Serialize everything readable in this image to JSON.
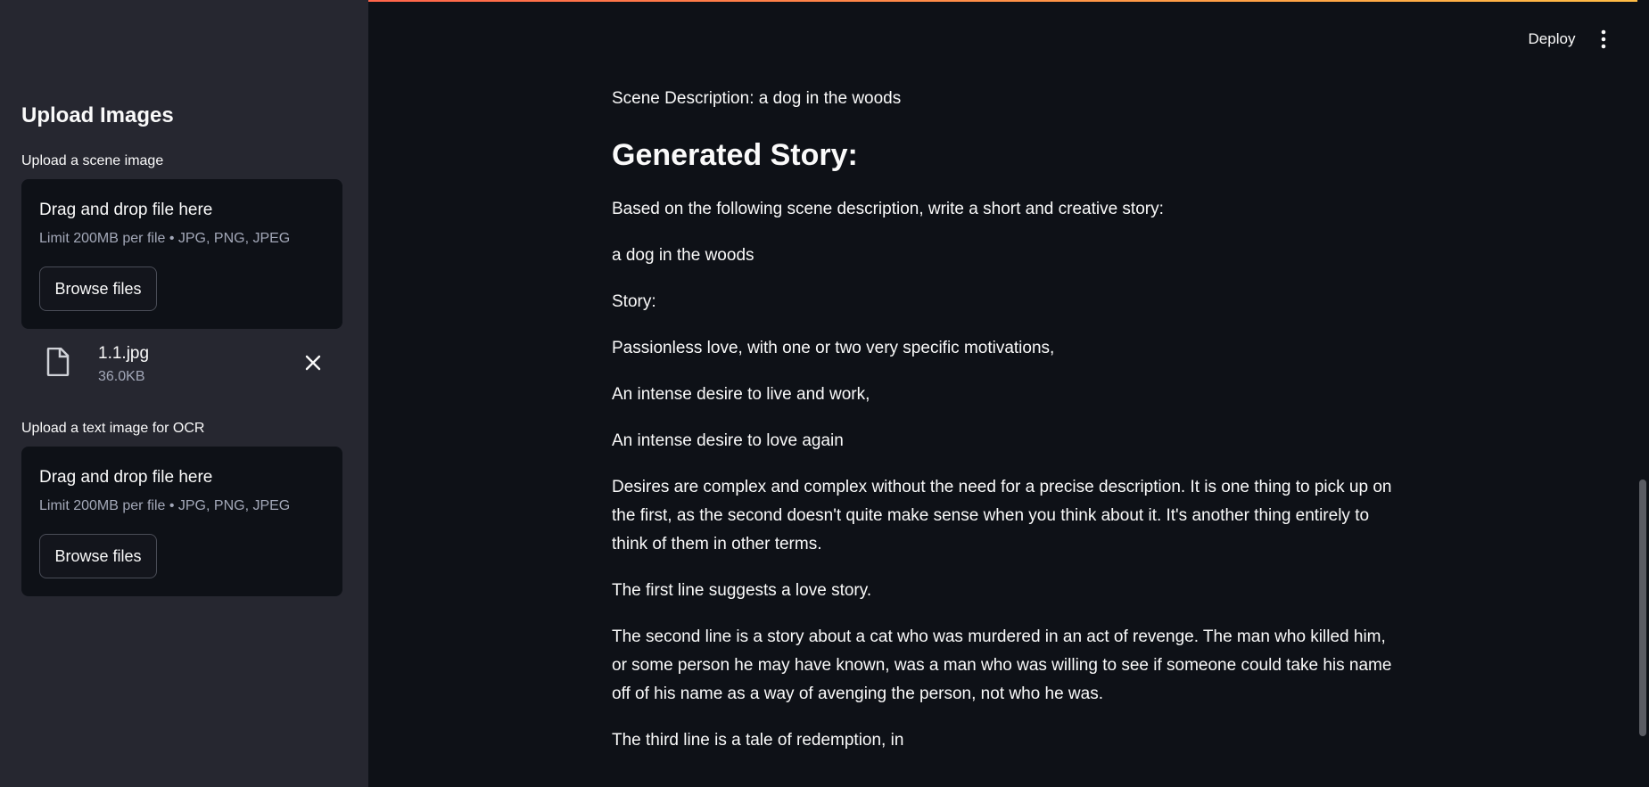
{
  "header": {
    "deploy_label": "Deploy",
    "menu_icon": "vertical-ellipsis-icon"
  },
  "sidebar": {
    "title": "Upload Images",
    "scene_uploader": {
      "label": "Upload a scene image",
      "drop_title": "Drag and drop file here",
      "drop_hint": "Limit 200MB per file • JPG, PNG, JPEG",
      "browse_label": "Browse files"
    },
    "uploaded_file": {
      "name": "1.1.jpg",
      "size": "36.0KB",
      "icon": "file-icon",
      "remove_icon": "close-icon"
    },
    "ocr_uploader": {
      "label": "Upload a text image for OCR",
      "drop_title": "Drag and drop file here",
      "drop_hint": "Limit 200MB per file • JPG, PNG, JPEG",
      "browse_label": "Browse files"
    }
  },
  "main": {
    "scene_description": "Scene Description: a dog in the woods",
    "heading": "Generated Story:",
    "paragraphs": [
      "Based on the following scene description, write a short and creative story:",
      "a dog in the woods",
      "Story:",
      "Passionless love, with one or two very specific motivations,",
      "An intense desire to live and work,",
      "An intense desire to love again",
      "Desires are complex and complex without the need for a precise description. It is one thing to pick up on the first, as the second doesn't quite make sense when you think about it. It's another thing entirely to think of them in other terms.",
      "The first line suggests a love story.",
      "The second line is a story about a cat who was murdered in an act of revenge. The man who killed him, or some person he may have known, was a man who was willing to see if someone could take his name off of his name as a way of avenging the person, not who he was.",
      "The third line is a tale of redemption, in"
    ]
  },
  "colors": {
    "app_background": "#0e1117",
    "sidebar_background": "#262730",
    "accent_red": "#ff4b4b",
    "muted_text": "#a3a8b8"
  }
}
